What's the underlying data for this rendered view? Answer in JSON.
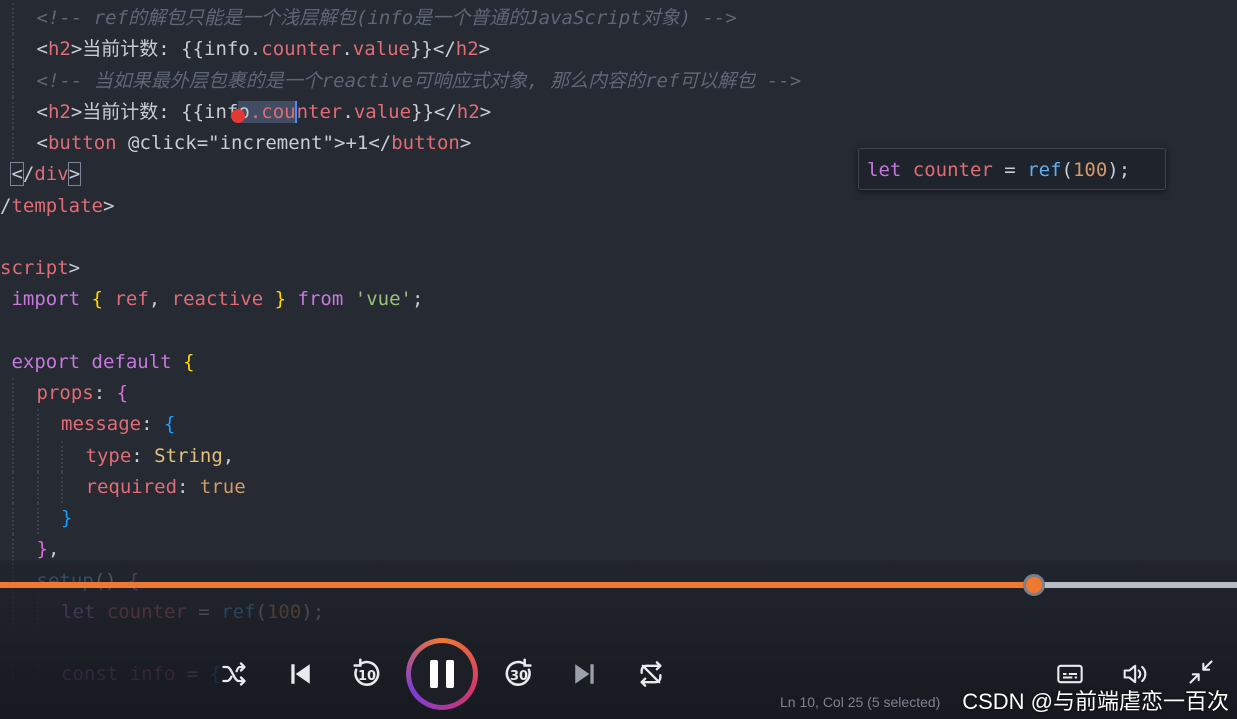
{
  "editor": {
    "lines": [
      {
        "indent": 1,
        "tokens": [
          {
            "c": "tok-comment",
            "t": "<!-- ref的解包只能是一个浅层解包(info是一个普通的JavaScript对象) -->"
          }
        ]
      },
      {
        "indent": 1,
        "tokens": [
          {
            "c": "tok-punct",
            "t": "<"
          },
          {
            "c": "tok-tag",
            "t": "h2"
          },
          {
            "c": "tok-punct",
            "t": ">"
          },
          {
            "c": "tok-text",
            "t": "当前计数: {{info."
          },
          {
            "c": "tok-var",
            "t": "counter"
          },
          {
            "c": "tok-text",
            "t": "."
          },
          {
            "c": "tok-var",
            "t": "value"
          },
          {
            "c": "tok-text",
            "t": "}}"
          },
          {
            "c": "tok-punct",
            "t": "</"
          },
          {
            "c": "tok-tag",
            "t": "h2"
          },
          {
            "c": "tok-punct",
            "t": ">"
          }
        ]
      },
      {
        "indent": 1,
        "tokens": [
          {
            "c": "tok-comment",
            "t": "<!-- 当如果最外层包裹的是一个reactive可响应式对象, 那么内容的ref可以解包 -->"
          }
        ]
      },
      {
        "indent": 1,
        "tokens": [
          {
            "c": "tok-punct",
            "t": "<"
          },
          {
            "c": "tok-tag",
            "t": "h2"
          },
          {
            "c": "tok-punct",
            "t": ">"
          },
          {
            "c": "tok-text",
            "t": "当前计数: {{inf"
          },
          {
            "c": "tok-text sel",
            "t": "o",
            "dot": true
          },
          {
            "c": "tok-var sel",
            "t": ".cou"
          },
          {
            "c": "cursor",
            "t": ""
          },
          {
            "c": "tok-var",
            "t": "nter"
          },
          {
            "c": "tok-text",
            "t": "."
          },
          {
            "c": "tok-var",
            "t": "value"
          },
          {
            "c": "tok-text",
            "t": "}}"
          },
          {
            "c": "tok-punct",
            "t": "</"
          },
          {
            "c": "tok-tag",
            "t": "h2"
          },
          {
            "c": "tok-punct",
            "t": ">"
          }
        ]
      },
      {
        "indent": 1,
        "tokens": [
          {
            "c": "tok-punct",
            "t": "<"
          },
          {
            "c": "tok-tag",
            "t": "button"
          },
          {
            "c": "tok-text",
            "t": " "
          },
          {
            "c": "tok-attr",
            "t": "@click"
          },
          {
            "c": "tok-punct",
            "t": "="
          },
          {
            "c": "tok-string",
            "t": "\"increment\""
          },
          {
            "c": "tok-punct",
            "t": ">"
          },
          {
            "c": "tok-text",
            "t": "+1"
          },
          {
            "c": "tok-punct",
            "t": "</"
          },
          {
            "c": "tok-tag",
            "t": "button"
          },
          {
            "c": "tok-punct",
            "t": ">"
          }
        ]
      },
      {
        "indent": 0,
        "lead": " ",
        "tokens": [
          {
            "c": "tok-punct bracket-box",
            "t": "<"
          },
          {
            "c": "tok-punct",
            "t": "/"
          },
          {
            "c": "tok-tag",
            "t": "div"
          },
          {
            "c": "tok-punct bracket-box",
            "t": ">"
          }
        ]
      },
      {
        "indent": 0,
        "lead": "",
        "tokens": [
          {
            "c": "tok-punct",
            "t": "/"
          },
          {
            "c": "tok-tag",
            "t": "template"
          },
          {
            "c": "tok-punct",
            "t": ">"
          }
        ]
      },
      {
        "indent": 0,
        "lead": "",
        "tokens": []
      },
      {
        "indent": 0,
        "lead": "",
        "tokens": [
          {
            "c": "tok-tag",
            "t": "script"
          },
          {
            "c": "tok-punct",
            "t": ">"
          }
        ]
      },
      {
        "indent": 0,
        "lead": " ",
        "tokens": [
          {
            "c": "tok-keyword",
            "t": "import"
          },
          {
            "c": "tok-text",
            "t": " "
          },
          {
            "c": "tok-brace",
            "t": "{"
          },
          {
            "c": "tok-text",
            "t": " "
          },
          {
            "c": "tok-var",
            "t": "ref"
          },
          {
            "c": "tok-text",
            "t": ", "
          },
          {
            "c": "tok-var",
            "t": "reactive"
          },
          {
            "c": "tok-text",
            "t": " "
          },
          {
            "c": "tok-brace",
            "t": "}"
          },
          {
            "c": "tok-text",
            "t": " "
          },
          {
            "c": "tok-keyword",
            "t": "from"
          },
          {
            "c": "tok-text",
            "t": " "
          },
          {
            "c": "tok-str-green",
            "t": "'vue'"
          },
          {
            "c": "tok-text",
            "t": ";"
          }
        ]
      },
      {
        "indent": 0,
        "lead": "",
        "tokens": []
      },
      {
        "indent": 0,
        "lead": " ",
        "tokens": [
          {
            "c": "tok-keyword",
            "t": "export"
          },
          {
            "c": "tok-text",
            "t": " "
          },
          {
            "c": "tok-keyword",
            "t": "default"
          },
          {
            "c": "tok-text",
            "t": " "
          },
          {
            "c": "tok-brace",
            "t": "{"
          }
        ]
      },
      {
        "indent": 1,
        "tokens": [
          {
            "c": "tok-prop",
            "t": "props"
          },
          {
            "c": "tok-text",
            "t": ": "
          },
          {
            "c": "tok-brace2",
            "t": "{"
          }
        ]
      },
      {
        "indent": 2,
        "tokens": [
          {
            "c": "tok-prop",
            "t": "message"
          },
          {
            "c": "tok-text",
            "t": ": "
          },
          {
            "c": "tok-brace3",
            "t": "{"
          }
        ]
      },
      {
        "indent": 3,
        "tokens": [
          {
            "c": "tok-prop",
            "t": "type"
          },
          {
            "c": "tok-text",
            "t": ": "
          },
          {
            "c": "tok-type",
            "t": "String"
          },
          {
            "c": "tok-text",
            "t": ","
          }
        ]
      },
      {
        "indent": 3,
        "tokens": [
          {
            "c": "tok-prop",
            "t": "required"
          },
          {
            "c": "tok-text",
            "t": ": "
          },
          {
            "c": "tok-bool",
            "t": "true"
          }
        ]
      },
      {
        "indent": 2,
        "tokens": [
          {
            "c": "tok-brace3",
            "t": "}"
          }
        ]
      },
      {
        "indent": 1,
        "tokens": [
          {
            "c": "tok-brace2",
            "t": "}"
          },
          {
            "c": "tok-text",
            "t": ","
          }
        ]
      },
      {
        "indent": 1,
        "tokens": [
          {
            "c": "tok-func",
            "t": "setup"
          },
          {
            "c": "tok-text",
            "t": "() "
          },
          {
            "c": "tok-brace2",
            "t": "{"
          }
        ]
      },
      {
        "indent": 2,
        "tokens": [
          {
            "c": "tok-keyword",
            "t": "let"
          },
          {
            "c": "tok-text",
            "t": " "
          },
          {
            "c": "tok-var",
            "t": "counter"
          },
          {
            "c": "tok-text",
            "t": " = "
          },
          {
            "c": "tok-func",
            "t": "ref"
          },
          {
            "c": "tok-text",
            "t": "("
          },
          {
            "c": "tok-number",
            "t": "100"
          },
          {
            "c": "tok-text",
            "t": ");"
          }
        ]
      },
      {
        "indent": 0,
        "lead": "",
        "tokens": []
      },
      {
        "indent": 2,
        "tokens": [
          {
            "c": "tok-keyword",
            "t": "const"
          },
          {
            "c": "tok-text",
            "t": " "
          },
          {
            "c": "tok-var",
            "t": "info"
          },
          {
            "c": "tok-text",
            "t": " = "
          },
          {
            "c": "tok-brace3",
            "t": "{"
          }
        ]
      }
    ]
  },
  "hover": {
    "tokens": [
      {
        "c": "tok-keyword",
        "t": "let"
      },
      {
        "c": "tok-text",
        "t": " "
      },
      {
        "c": "tok-var",
        "t": "counter"
      },
      {
        "c": "tok-text",
        "t": " = "
      },
      {
        "c": "tok-func",
        "t": "ref"
      },
      {
        "c": "tok-text",
        "t": "("
      },
      {
        "c": "tok-number",
        "t": "100"
      },
      {
        "c": "tok-text",
        "t": ");"
      }
    ]
  },
  "player": {
    "progress_fraction": 0.836,
    "accent_color": "#f07830",
    "skip_back_seconds": "10",
    "skip_forward_seconds": "30",
    "icons": [
      "shuffle-icon",
      "previous-icon",
      "rewind-10-icon",
      "pause-icon",
      "forward-30-icon",
      "next-icon",
      "repeat-icon",
      "subtitles-icon",
      "volume-icon",
      "exit-fullscreen-icon"
    ]
  },
  "status_bar": {
    "text": "Ln 10, Col 25 (5 selected)"
  },
  "watermark": {
    "text": "CSDN @与前端虐恋一百次"
  }
}
